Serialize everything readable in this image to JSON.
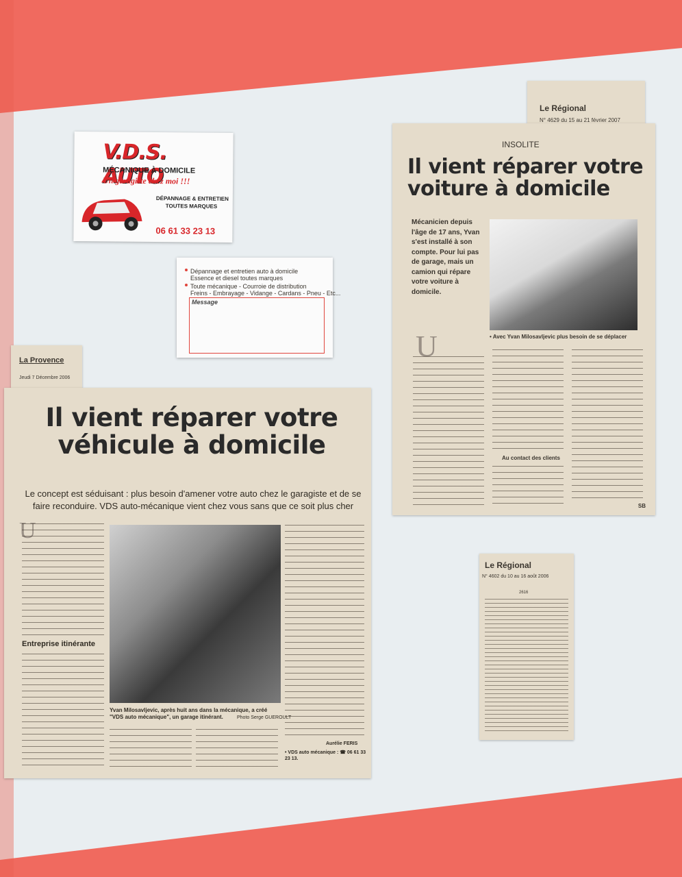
{
  "colors": {
    "red": "#f06a5f",
    "board": "#e9eef1",
    "paper": "#e5dccb"
  },
  "card_front": {
    "logo": "V.D.S. AUTO",
    "line1": "MÉCANIQUE À DOMICILE",
    "tagline": "Un garagiste chez moi !!!",
    "services": "DÉPANNAGE & ENTRETIEN",
    "services2": "TOUTES MARQUES",
    "phone": "06 61 33 23 13"
  },
  "card_back": {
    "item1": "Dépannage et entretien auto à domicile",
    "item1b": "Essence et diesel toutes marques",
    "item2": "Toute mécanique - Courroie de distribution",
    "item2b": "Freins - Embrayage - Vidange - Cardans - Pneu - Etc...",
    "message_label": "Message"
  },
  "clip_regional_top": {
    "pub": "Le Régional",
    "issue": "N° 4629 du 15 au 21 février 2007",
    "kicker": "INSOLITE",
    "headline": "Il vient réparer votre voiture à domicile",
    "intro": "Mécanicien depuis l'âge de 17 ans, Yvan s'est installé à son compte. Pour lui pas de garage, mais un camion qui répare votre voiture à domicile.",
    "caption": "• Avec Yvan Milosavljevic plus besoin de se déplacer",
    "subhead": "Au contact des clients",
    "signature": "SB"
  },
  "clip_provence": {
    "pub": "La Provence",
    "date": "Jeudi 7 Décembre 2006",
    "headline": "Il vient réparer votre véhicule à domicile",
    "lede": "Le concept est séduisant : plus besoin d'amener votre auto chez le garagiste et de se faire reconduire. VDS auto-mécanique vient chez vous sans que ce soit plus cher",
    "subhead": "Entreprise itinérante",
    "caption": "Yvan Milosavljevic, après huit ans dans la mécanique, a créé \"VDS auto mécanique\", un garage itinérant.",
    "photo_credit": "Photo Serge GUEROULT",
    "author": "Aurélie FERIS",
    "contact": "• VDS auto mécanique : ☎ 06 61 33 23 13."
  },
  "clip_regional_bottom": {
    "pub": "Le Régional",
    "issue": "N° 4602 du 10 au 16 août 2006",
    "ref": "2616"
  }
}
